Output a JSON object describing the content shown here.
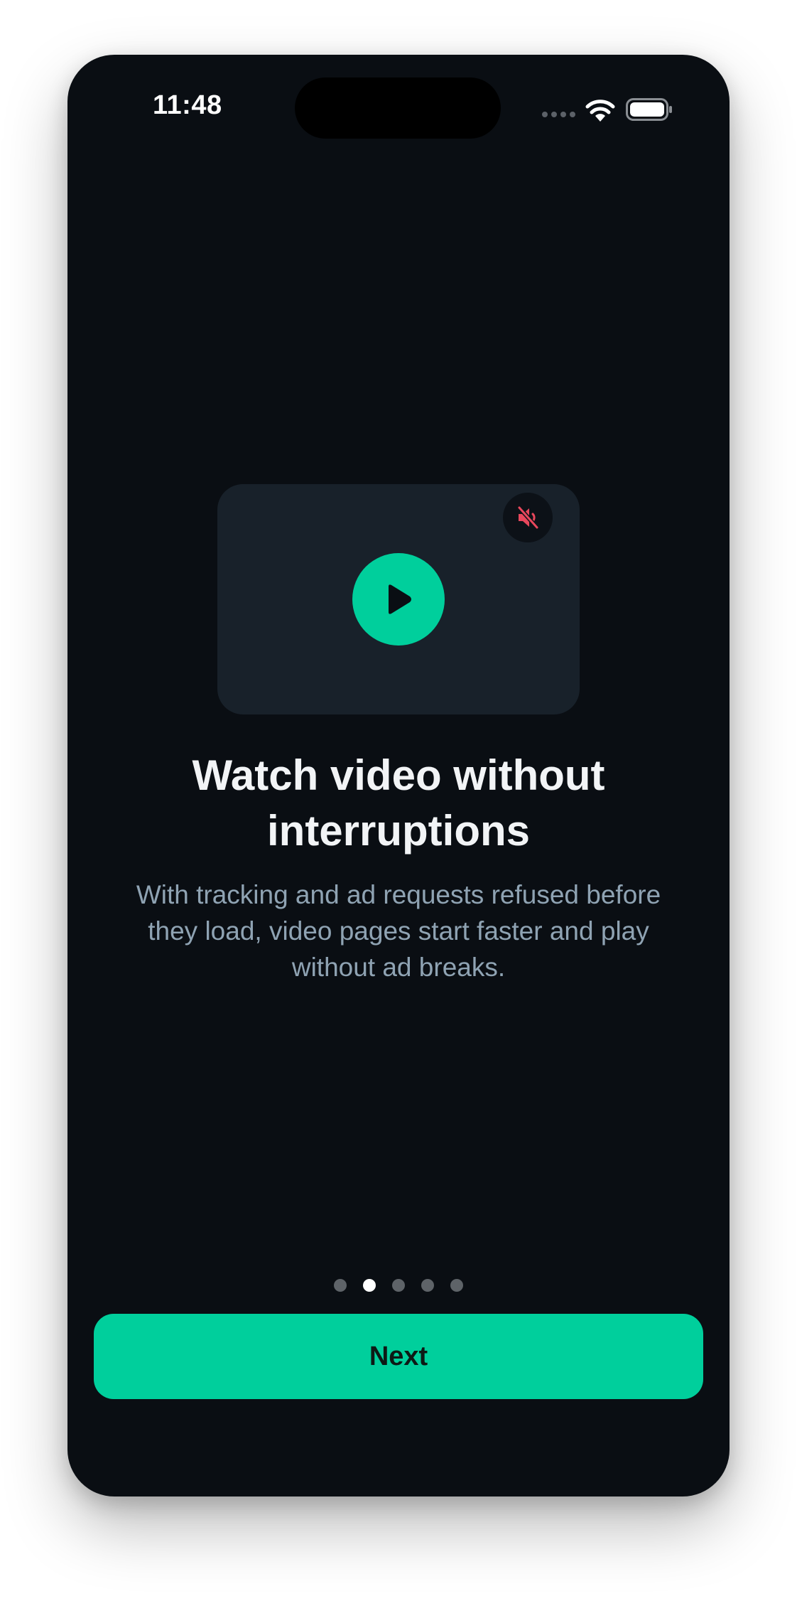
{
  "status_bar": {
    "time": "11:48",
    "icons": [
      "signal-icon",
      "wifi-icon",
      "battery-icon"
    ]
  },
  "video_card": {
    "play_icon": "play-icon",
    "mute_icon": "muted-speaker-icon",
    "mute_icon_color": "#e8475c"
  },
  "onboarding": {
    "title": "Watch video without interruptions",
    "description": "With tracking and ad requests refused before they load, video pages start faster and play without ad breaks.",
    "page_indicator": {
      "total": 5,
      "active_index": 1
    },
    "next_label": "Next"
  },
  "colors": {
    "background": "#0a0e13",
    "accent": "#00cf9c",
    "card": "#18212a",
    "body_text": "#8fa3b3"
  }
}
